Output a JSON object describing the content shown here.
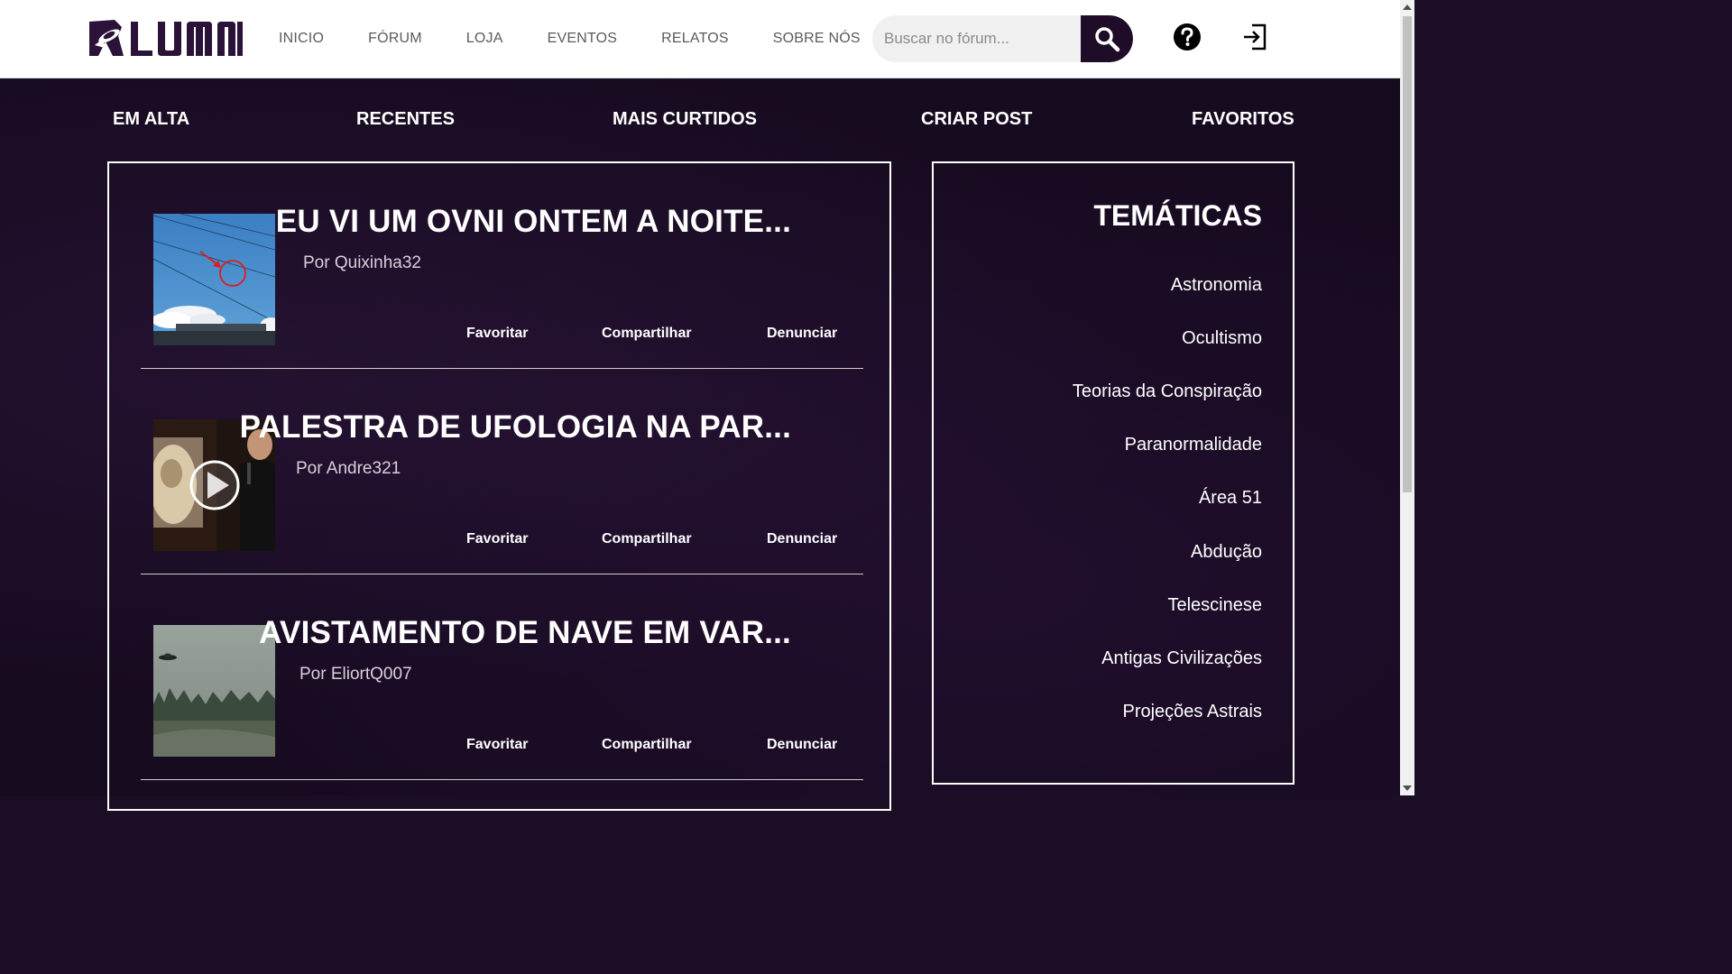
{
  "header": {
    "logo_text": "LUMNI",
    "nav": [
      {
        "label": "INICIO"
      },
      {
        "label": "FÓRUM"
      },
      {
        "label": "LOJA"
      },
      {
        "label": "EVENTOS"
      },
      {
        "label": "RELATOS"
      },
      {
        "label": "SOBRE NÓS"
      }
    ],
    "search": {
      "placeholder": "Buscar no fórum...",
      "value": "",
      "icon": "search-icon"
    },
    "help_icon": "help-circle-icon",
    "login_icon": "login-icon"
  },
  "tabs": [
    {
      "label": "EM ALTA"
    },
    {
      "label": "RECENTES"
    },
    {
      "label": "MAIS CURTIDOS"
    },
    {
      "label": "CRIAR POST"
    },
    {
      "label": "FAVORITOS"
    }
  ],
  "posts": [
    {
      "title": "EU VI UM OVNI ONTEM A NOITE...",
      "author": "Por Quixinha32",
      "thumbnail": "sky-with-circled-ufo-image",
      "actions": {
        "favorite": "Favoritar",
        "share": "Compartilhar",
        "report": "Denunciar"
      }
    },
    {
      "title": "PALESTRA DE UFOLOGIA NA PAR...",
      "author": "Por Andre321",
      "thumbnail": "lecture-video-thumbnail",
      "actions": {
        "favorite": "Favoritar",
        "share": "Compartilhar",
        "report": "Denunciar"
      }
    },
    {
      "title": "AVISTAMENTO DE NAVE EM VAR...",
      "author": "Por EliortQ007",
      "thumbnail": "flying-saucer-over-trees-image",
      "actions": {
        "favorite": "Favoritar",
        "share": "Compartilhar",
        "report": "Denunciar"
      }
    }
  ],
  "topics": {
    "title": "TEMÁTICAS",
    "items": [
      {
        "label": "Astronomia"
      },
      {
        "label": "Ocultismo"
      },
      {
        "label": "Teorias da Conspiração"
      },
      {
        "label": "Paranormalidade"
      },
      {
        "label": "Área 51"
      },
      {
        "label": "Abdução"
      },
      {
        "label": "Telescinese"
      },
      {
        "label": "Antigas Civilizações"
      },
      {
        "label": "Projeções Astrais"
      }
    ]
  },
  "colors": {
    "brand": "#1e0c28",
    "background": "#170b20",
    "text_light": "#ffffff",
    "nav_text": "#5b5b5b"
  }
}
